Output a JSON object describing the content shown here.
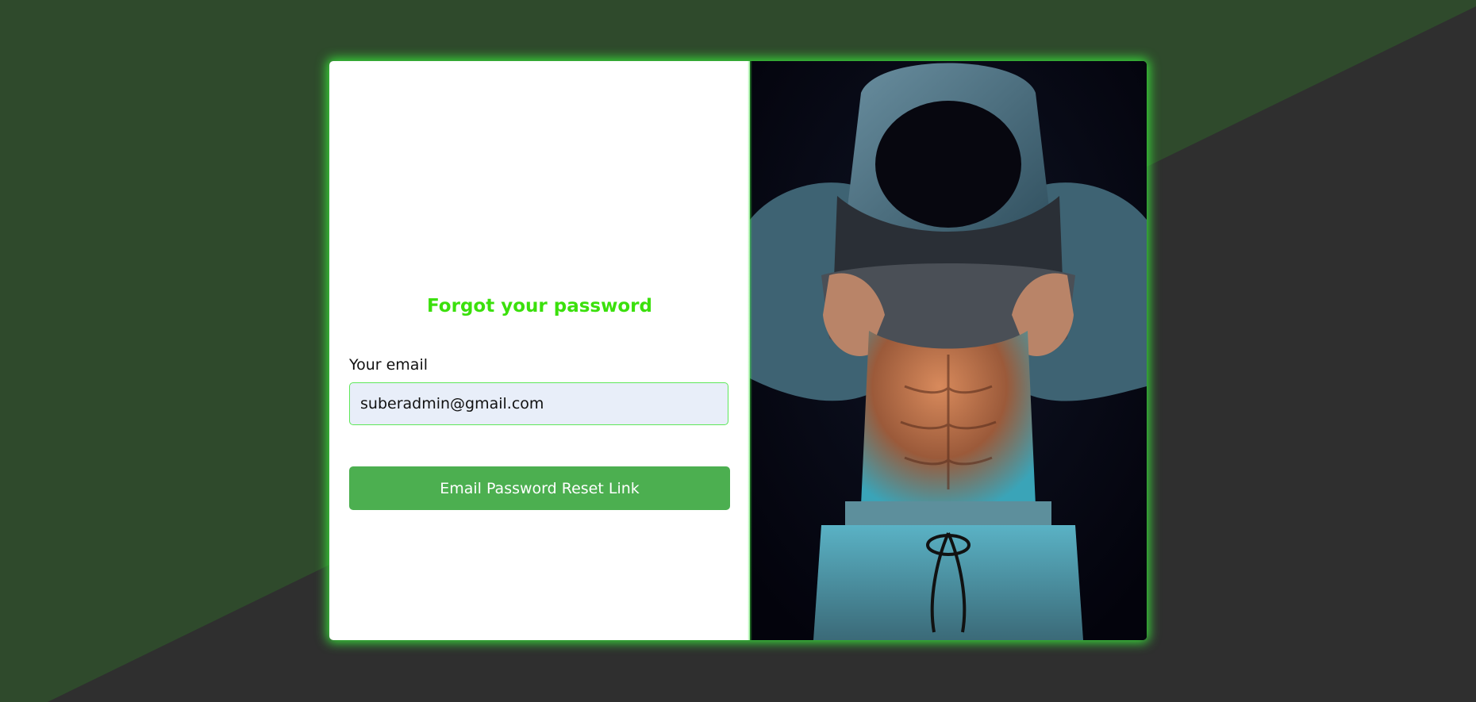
{
  "page": {
    "title": "Forgot your password"
  },
  "form": {
    "email_label": "Your email",
    "email_value": "suberadmin@gmail.com",
    "submit_label": "Email Password Reset Link"
  },
  "colors": {
    "background_dark": "#2f2f2f",
    "background_green": "#2f4a2c",
    "accent_glow": "#39e03a",
    "title_green": "#3be00c",
    "button_green": "#4caf50",
    "input_bg": "#e8eef9"
  },
  "image": {
    "subject": "athlete-in-hoodie-photo"
  }
}
